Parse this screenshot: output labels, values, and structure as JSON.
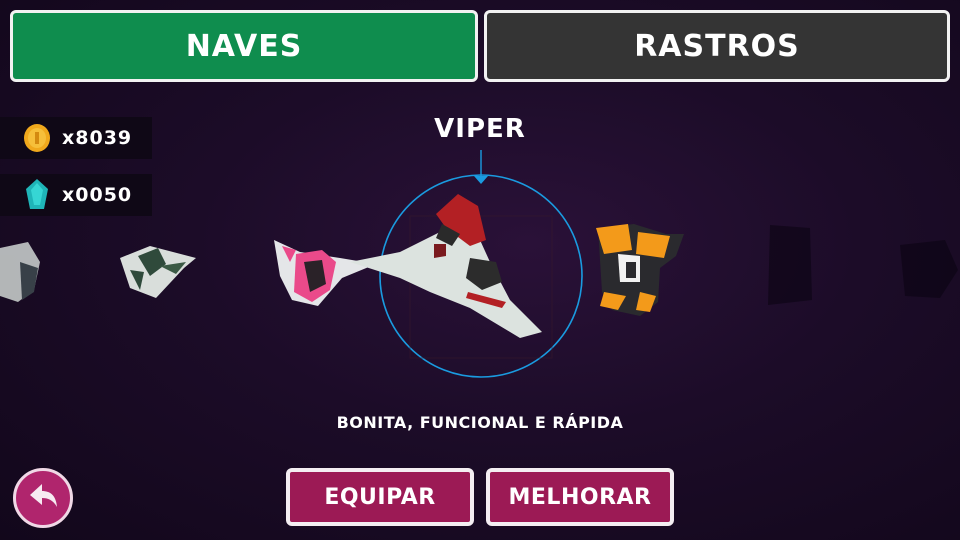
{
  "tabs": [
    {
      "label": "NAVES",
      "active": true,
      "color": "#0f8d4e"
    },
    {
      "label": "RASTROS",
      "active": false,
      "color": "#343434"
    }
  ],
  "currency": {
    "coins": {
      "icon": "coin-icon",
      "amount": "x8039"
    },
    "gems": {
      "icon": "gem-icon",
      "amount": "x0050"
    }
  },
  "ship": {
    "name": "VIPER",
    "description": "BONITA, FUNCIONAL E RÁPIDA"
  },
  "actions": {
    "equip": "EQUIPAR",
    "upgrade": "MELHORAR",
    "back_icon": "back-arrow-icon"
  },
  "colors": {
    "accent": "#9c1a55",
    "selector_ring": "#1a9be0"
  }
}
